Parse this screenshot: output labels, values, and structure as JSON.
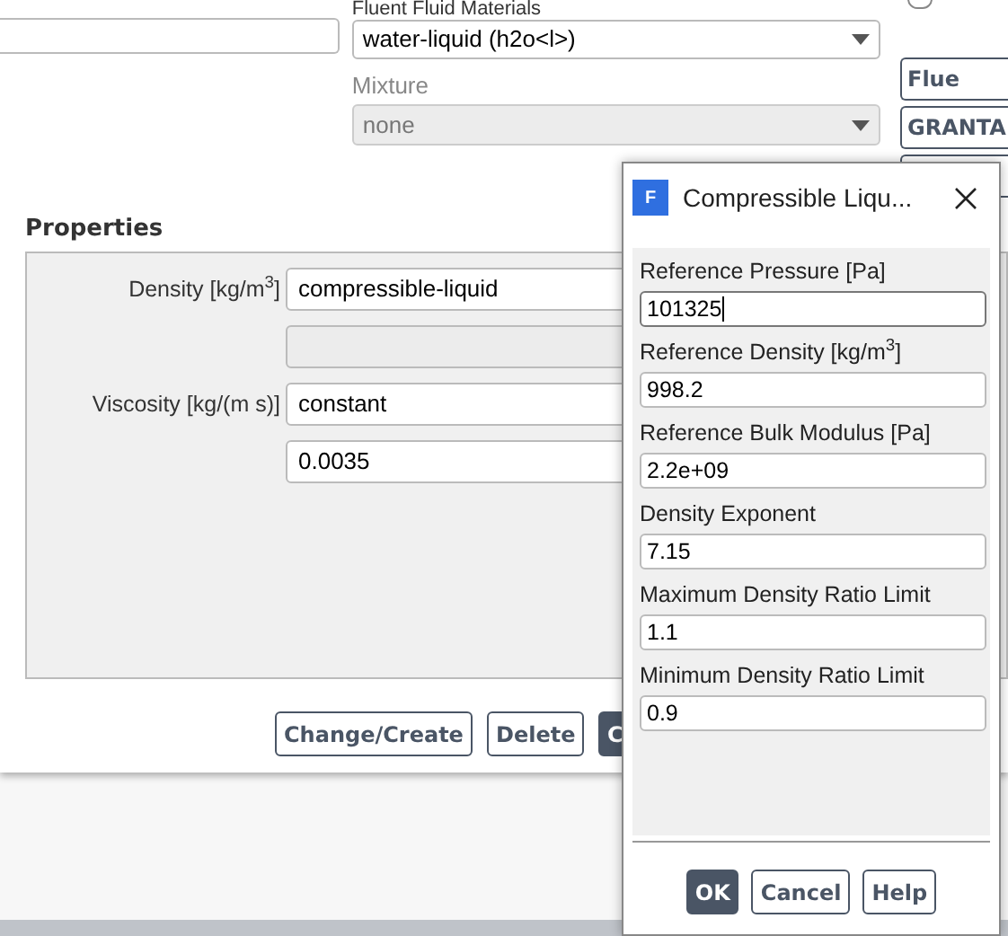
{
  "materials": {
    "label": "Fluent Fluid Materials",
    "value": "water-liquid (h2o<l>)"
  },
  "mixture": {
    "label": "Mixture",
    "value": "none",
    "disabled": true
  },
  "radio": {
    "selected": false
  },
  "side_buttons": [
    "Flue",
    "GRANTA"
  ],
  "properties": {
    "title": "Properties",
    "rows": [
      {
        "label": "Density [kg/m$^{3}$]",
        "value": "compressible-liquid",
        "disabled": false
      },
      {
        "label": "",
        "value": "",
        "disabled": true
      },
      {
        "label": "Viscosity [kg/(m s)]",
        "value": "constant",
        "disabled": false
      },
      {
        "label": "",
        "value": "0.0035",
        "disabled": false
      }
    ]
  },
  "actions": [
    {
      "label": "Change/Create",
      "primary": false
    },
    {
      "label": "Delete",
      "primary": false
    },
    {
      "label": "C",
      "primary": true
    }
  ],
  "dialog": {
    "title": "Compressible Liqu...",
    "icon_letter": "F",
    "fields": [
      {
        "label": "Reference Pressure [Pa]",
        "value": "101325",
        "focused": true
      },
      {
        "label": "Reference Density [kg/m$^{3}$]",
        "value": "998.2",
        "focused": false
      },
      {
        "label": "Reference Bulk Modulus [Pa]",
        "value": "2.2e+09",
        "focused": false
      },
      {
        "label": "Density Exponent",
        "value": "7.15",
        "focused": false
      },
      {
        "label": "Maximum Density Ratio Limit",
        "value": "1.1",
        "focused": false
      },
      {
        "label": "Minimum Density Ratio Limit",
        "value": "0.9",
        "focused": false
      }
    ],
    "buttons": [
      {
        "label": "OK",
        "primary": true
      },
      {
        "label": "Cancel",
        "primary": false
      },
      {
        "label": "Help",
        "primary": false
      }
    ]
  }
}
